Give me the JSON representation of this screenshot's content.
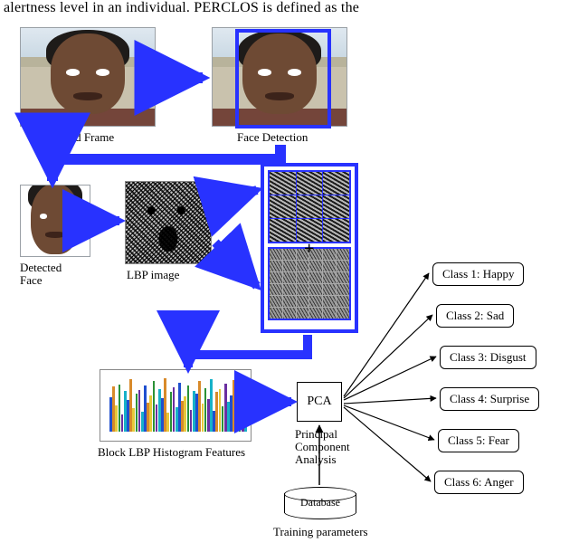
{
  "top_text": "alertness level in an individual. PERCLOS is defined as the",
  "captions": {
    "captured_frame": "Captured Frame",
    "face_detection": "Face Detection",
    "detected_face_line1": "Detected",
    "detected_face_line2": "Face",
    "lbp_image": "LBP image",
    "hist_features": "Block LBP Histogram Features",
    "pca": "PCA",
    "pca_sub_line1": "Principal",
    "pca_sub_line2": "Component",
    "pca_sub_line3": "Analysis",
    "database": "Database",
    "training_params": "Training parameters"
  },
  "classes": [
    "Class 1: Happy",
    "Class 2: Sad",
    "Class 3: Disgust",
    "Class 4: Surprise",
    "Class 5: Fear",
    "Class 6: Anger"
  ],
  "hist_meta": {
    "colors": [
      "#1f4fcf",
      "#d88a2a",
      "#e7c93a",
      "#2a9136",
      "#6a2fa0",
      "#17b1c8"
    ],
    "heights_pct": [
      60,
      78,
      45,
      82,
      30,
      70,
      55,
      90,
      40,
      66,
      72,
      35,
      80,
      50,
      63,
      88,
      47,
      74,
      58,
      92,
      33,
      69,
      77,
      42,
      85,
      53,
      61,
      79,
      38,
      71,
      65,
      87,
      49,
      75,
      57,
      91,
      36,
      68,
      73,
      44,
      83,
      52,
      62,
      89,
      48,
      76,
      59,
      93
    ]
  }
}
